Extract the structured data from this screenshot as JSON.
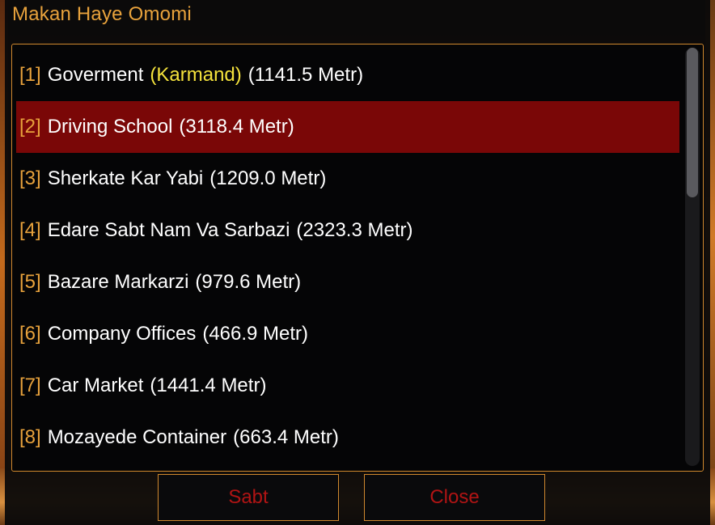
{
  "dialog": {
    "title": "Makan Haye Omomi"
  },
  "list": {
    "items": [
      {
        "index": "[1]",
        "name": "Goverment",
        "highlight": "(Karmand)",
        "distance": "(1141.5 Metr)",
        "selected": false
      },
      {
        "index": "[2]",
        "name": "Driving School",
        "highlight": "",
        "distance": "(3118.4 Metr)",
        "selected": true
      },
      {
        "index": "[3]",
        "name": "Sherkate Kar Yabi",
        "highlight": "",
        "distance": "(1209.0 Metr)",
        "selected": false
      },
      {
        "index": "[4]",
        "name": "Edare Sabt Nam Va Sarbazi",
        "highlight": "",
        "distance": "(2323.3 Metr)",
        "selected": false
      },
      {
        "index": "[5]",
        "name": "Bazare Markarzi",
        "highlight": "",
        "distance": "(979.6 Metr)",
        "selected": false
      },
      {
        "index": "[6]",
        "name": "Company Offices",
        "highlight": "",
        "distance": "(466.9 Metr)",
        "selected": false
      },
      {
        "index": "[7]",
        "name": "Car Market",
        "highlight": "",
        "distance": "(1441.4 Metr)",
        "selected": false
      },
      {
        "index": "[8]",
        "name": "Mozayede Container",
        "highlight": "",
        "distance": "(663.4 Metr)",
        "selected": false
      }
    ]
  },
  "buttons": {
    "sabt_label": "Sabt",
    "close_label": "Close"
  },
  "colors": {
    "accent": "#e8a23c",
    "highlight_text": "#f4e23c",
    "selected_row": "#7a0707",
    "button_text": "#b01414"
  }
}
